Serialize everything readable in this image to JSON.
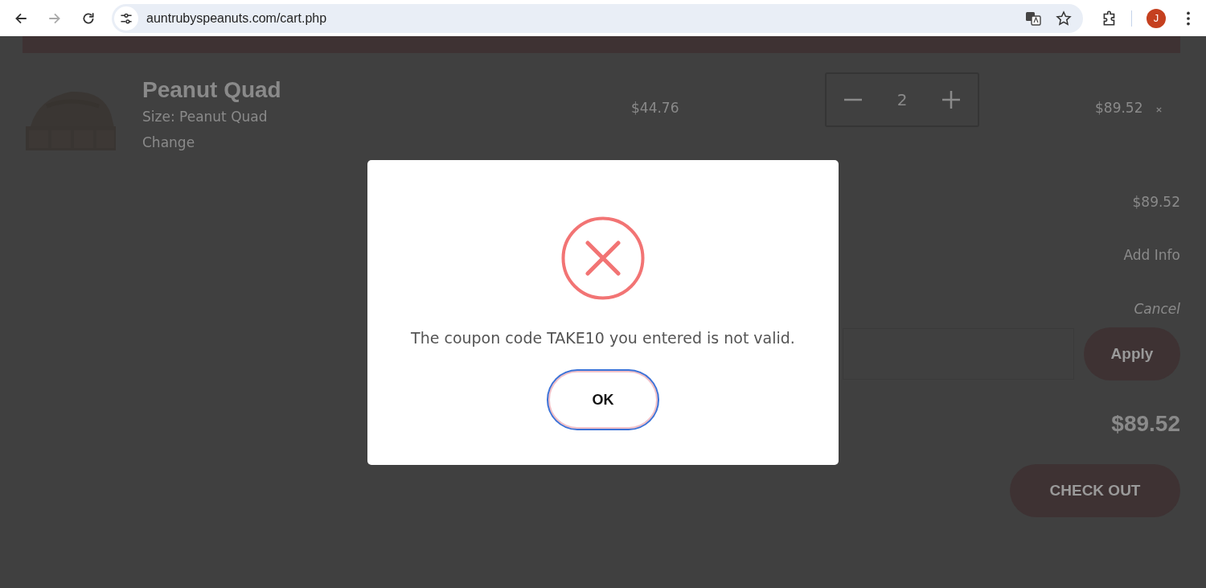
{
  "browser": {
    "url": "auntrubyspeanuts.com/cart.php",
    "profile_initial": "J"
  },
  "cart_item": {
    "title": "Peanut Quad",
    "size_label": "Size:",
    "size_value": "Peanut Quad",
    "change_link": "Change",
    "unit_price": "$44.76",
    "quantity": "2",
    "line_total": "$89.52"
  },
  "summary": {
    "subtotal": "$89.52",
    "add_info": "Add Info",
    "cancel": "Cancel",
    "apply_button": "Apply",
    "total": "$89.52",
    "checkout_button": "CHECK OUT"
  },
  "dialog": {
    "message": "The coupon code TAKE10 you entered is not valid.",
    "ok_button": "OK"
  }
}
